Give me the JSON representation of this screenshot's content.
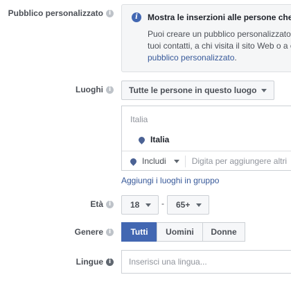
{
  "custom_audience": {
    "label": "Pubblico personalizzato",
    "notice_title": "Mostra le inserzioni alle persone che",
    "notice_line1": "Puoi creare un pubblico personalizzato",
    "notice_line2": "tuoi contatti, a chi visita il sito Web o a c",
    "notice_link": "pubblico personalizzato",
    "notice_link_suffix": "."
  },
  "locations": {
    "label": "Luoghi",
    "dropdown_value": "Tutte le persone in questo luogo",
    "country_header": "Italia",
    "selected_item": "Italia",
    "include_value": "Includi",
    "search_placeholder": "Digita per aggiungere altri",
    "group_link": "Aggiungi i luoghi in gruppo"
  },
  "age": {
    "label": "Età",
    "min": "18",
    "separator": "-",
    "max": "65+"
  },
  "gender": {
    "label": "Genere",
    "options": [
      "Tutti",
      "Uomini",
      "Donne"
    ],
    "selected": "Tutti"
  },
  "languages": {
    "label": "Lingue",
    "placeholder": "Inserisci una lingua..."
  },
  "icons": {
    "info": "i",
    "notice_info": "i"
  },
  "colors": {
    "accent": "#4267b2",
    "link": "#365899",
    "notice_bg": "#f5f6f7"
  }
}
